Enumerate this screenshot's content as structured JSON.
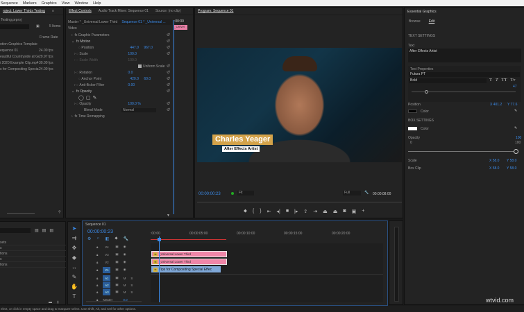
{
  "menu": [
    "Sequence",
    "Markers",
    "Graphics",
    "View",
    "Window",
    "Help"
  ],
  "project": {
    "tab": "roject: Lower Thirds Testing",
    "file": "Testing.prproj",
    "items_count": "5 Items",
    "col_frame_rate": "Frame Rate",
    "items": [
      {
        "name": "otion Graphics Template",
        "rate": ""
      },
      {
        "name": "equence 01",
        "rate": "24.00 fps"
      },
      {
        "name": "eautiful Countryside at Gol",
        "rate": "29.97 fps"
      },
      {
        "name": "i 2020 Example Clip.mp4",
        "rate": "30.00 fps"
      },
      {
        "name": "s for Compositing Specia",
        "rate": "24.00 fps"
      }
    ]
  },
  "effect_controls": {
    "tabs": [
      "Effect Controls",
      "Audio Track Mixer: Sequence 01",
      "Source: (no clip)"
    ],
    "master": "Master * _Universal Lower Third",
    "sequence": "Sequence 01 * _Universal ...",
    "time": ":00:00",
    "clip_label": "_Univer",
    "video_label": "Video",
    "rows": [
      {
        "name": "Graphic Parameters",
        "v1": "",
        "v2": ""
      },
      {
        "name": "Motion",
        "v1": "",
        "v2": ""
      },
      {
        "name": "Position",
        "v1": "447.0",
        "v2": "967.0"
      },
      {
        "name": "Scale",
        "v1": "100.0",
        "v2": ""
      },
      {
        "name": "Scale Width",
        "v1": "100.0",
        "v2": ""
      },
      {
        "name": "Uniform Scale",
        "v1": "",
        "v2": ""
      },
      {
        "name": "Rotation",
        "v1": "0.0",
        "v2": ""
      },
      {
        "name": "Anchor Point",
        "v1": "420.0",
        "v2": "60.0"
      },
      {
        "name": "Anti-flicker Filter",
        "v1": "0.00",
        "v2": ""
      },
      {
        "name": "Opacity",
        "v1": "",
        "v2": ""
      },
      {
        "name": "",
        "v1": "",
        "v2": ""
      },
      {
        "name": "Opacity",
        "v1": "100.0 %",
        "v2": ""
      },
      {
        "name": "Blend Mode",
        "v1": "Normal",
        "v2": ""
      },
      {
        "name": "Time Remapping",
        "v1": "",
        "v2": ""
      }
    ]
  },
  "program": {
    "tab": "Program: Sequence 01",
    "title": "Charles Yeager",
    "subtitle": "After Effects Artist",
    "timecode": "00:00:00:23",
    "fit": "Fit",
    "quality": "Full",
    "duration": "00:00:08:00"
  },
  "essential": {
    "tab": "Essential Graphics",
    "tabs": [
      "Browse",
      "Edit"
    ],
    "text_settings": "TEXT SETTINGS",
    "text_label": "Text",
    "text_value": "After Effects Artist",
    "text_props": "Text Properties",
    "font": "Futura PT",
    "style": "Bold",
    "size": "47",
    "position_label": "Position",
    "pos_x": "X 401.2",
    "pos_y": "Y 77.6",
    "color_label": "Color",
    "box_settings": "BOX SETTINGS",
    "box_color_label": "Color",
    "opacity_label": "Opacity",
    "opacity_value": "100",
    "opacity_min": "0",
    "opacity_max": "100",
    "scale_label": "Scale",
    "scale_x": "X 58.0",
    "scale_y": "Y 58.0",
    "boxclip_label": "Box Clip",
    "boxclip_x": "X 58.0",
    "boxclip_y": "Y 58.0",
    "text_color": "#000000",
    "box_color": "#ffffff"
  },
  "effects": {
    "items": [
      "sets",
      "s",
      "tions",
      "s",
      "tions"
    ]
  },
  "timeline": {
    "tab": "Sequence 01",
    "timecode": "00:00:00:23",
    "ruler": [
      ":00:00",
      "00:00:05:00",
      "00:00:10:00",
      "00:00:15:00",
      "00:00:20:00"
    ],
    "video_tracks": [
      "V4",
      "V3",
      "V2",
      "V1"
    ],
    "audio_tracks": [
      "A1",
      "A2",
      "A3"
    ],
    "master": "Master",
    "master_val": "0.0",
    "clips": [
      "_Universal Lower Third",
      "_Universal Lower Third",
      "Tips for Compositing Special Effec"
    ]
  },
  "status": "elect, or click in empty space and drag to marquee select. Use Shift, Alt, and Ctrl for other options.",
  "watermark": "wtvid.com"
}
